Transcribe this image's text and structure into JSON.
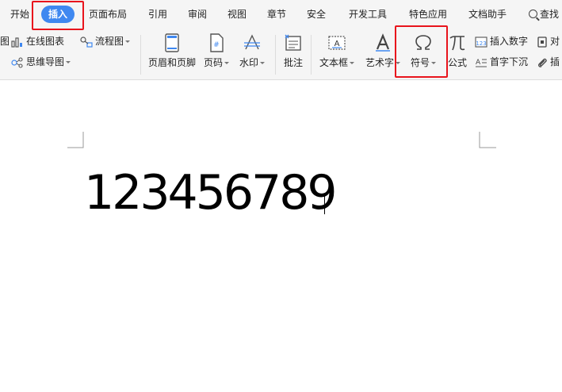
{
  "tabs": [
    {
      "id": "start",
      "label": "开始"
    },
    {
      "id": "insert",
      "label": "插入"
    },
    {
      "id": "layout",
      "label": "页面布局"
    },
    {
      "id": "reference",
      "label": "引用"
    },
    {
      "id": "review",
      "label": "审阅"
    },
    {
      "id": "view",
      "label": "视图"
    },
    {
      "id": "chapter",
      "label": "章节"
    },
    {
      "id": "security",
      "label": "安全"
    },
    {
      "id": "devtools",
      "label": "开发工具"
    },
    {
      "id": "features",
      "label": "特色应用"
    },
    {
      "id": "assistant",
      "label": "文档助手"
    }
  ],
  "search_label": "查找",
  "ribbon": {
    "partial_left_label": "图",
    "online_chart": "在线图表",
    "flowchart": "流程图",
    "mindmap": "思维导图",
    "header_footer": "页眉和页脚",
    "page_number": "页码",
    "watermark": "水印",
    "comment": "批注",
    "textbox": "文本框",
    "wordart": "艺术字",
    "symbol": "符号",
    "formula": "公式",
    "insert_number": "插入数字",
    "drop_cap": "首字下沉",
    "object_partial": "对",
    "attachment_partial": "插"
  },
  "document": {
    "text": "123456789"
  },
  "colors": {
    "accent": "#3f88f0",
    "highlight": "#e8141c",
    "ribbon_bg": "#f5f5f5"
  }
}
